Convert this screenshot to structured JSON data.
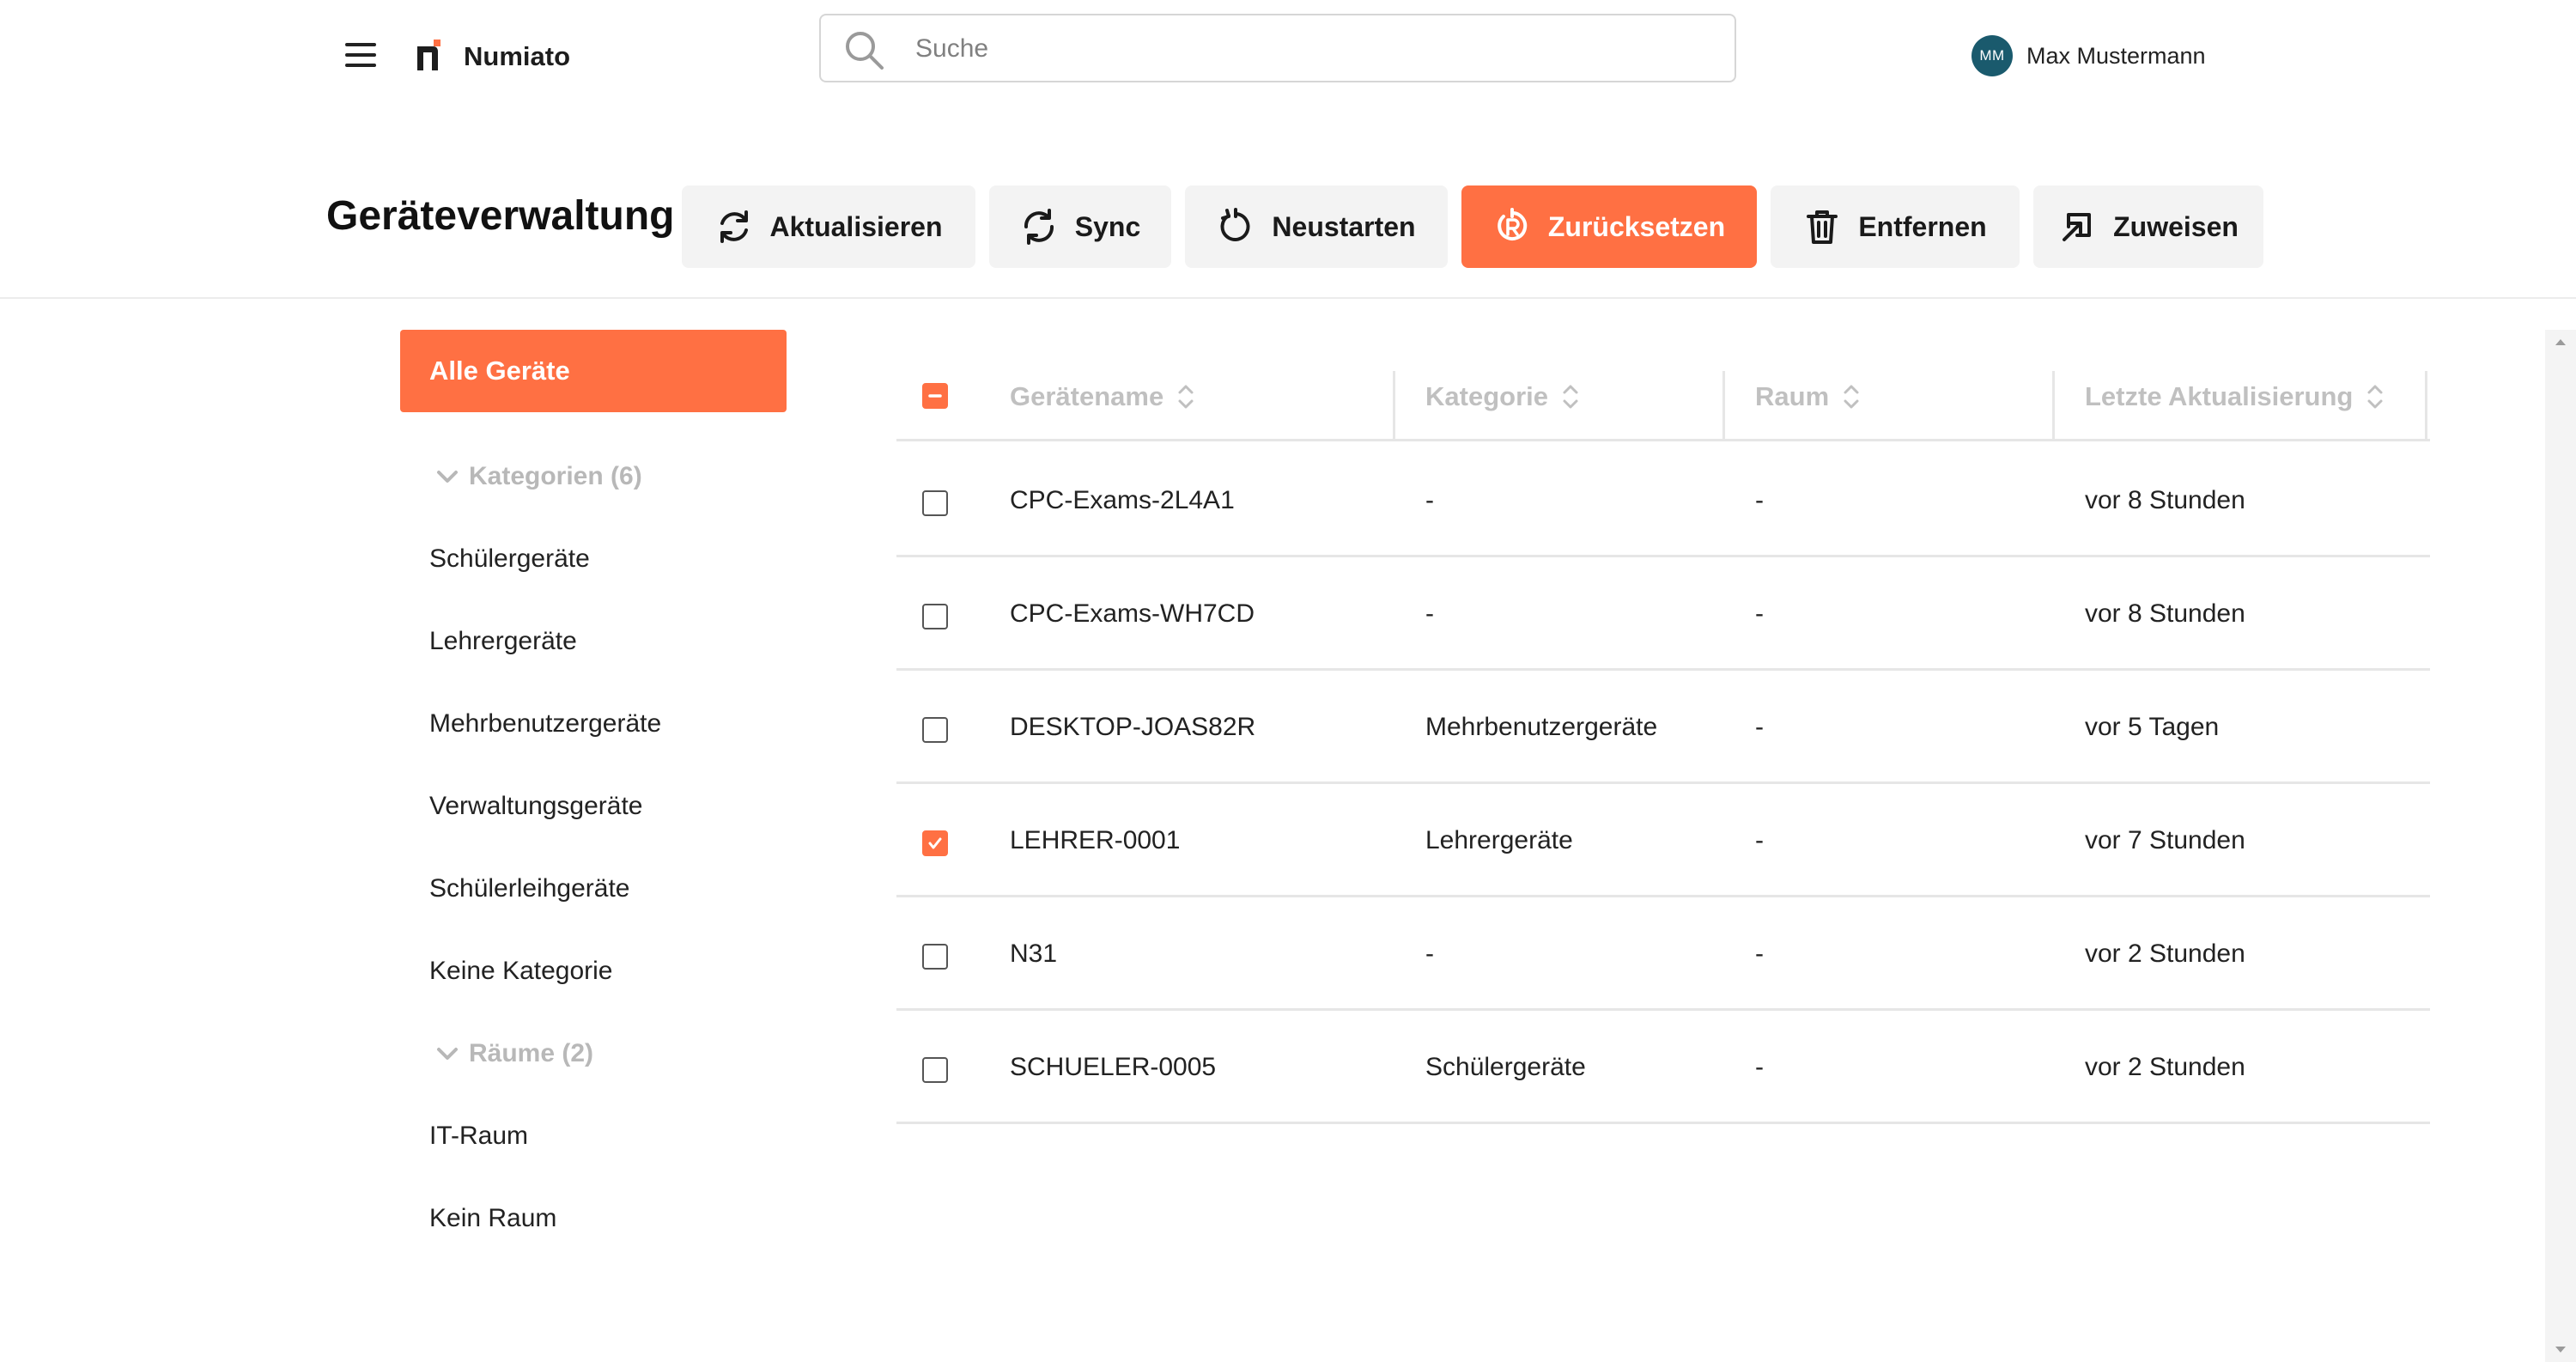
{
  "header": {
    "brand": "Numiato",
    "search_placeholder": "Suche",
    "user": {
      "initials": "MM",
      "name": "Max Mustermann"
    }
  },
  "page": {
    "title": "Geräteverwaltung",
    "actions": [
      {
        "label": "Aktualisieren",
        "icon": "refresh-icon"
      },
      {
        "label": "Sync",
        "icon": "sync-icon"
      },
      {
        "label": "Neustarten",
        "icon": "restart-icon"
      },
      {
        "label": "Zurücksetzen",
        "icon": "reset-icon",
        "primary": true
      },
      {
        "label": "Entfernen",
        "icon": "trash-icon"
      },
      {
        "label": "Zuweisen",
        "icon": "assign-icon"
      }
    ]
  },
  "sidebar": {
    "all_devices": "Alle Geräte",
    "categories_header": "Kategorien (6)",
    "categories": [
      "Schülergeräte",
      "Lehrergeräte",
      "Mehrbenutzergeräte",
      "Verwaltungsgeräte",
      "Schülerleihgeräte",
      "Keine Kategorie"
    ],
    "rooms_header": "Räume (2)",
    "rooms": [
      "IT-Raum",
      "Kein Raum"
    ]
  },
  "table": {
    "columns": [
      "Gerätename",
      "Kategorie",
      "Raum",
      "Letzte Aktualisierung"
    ],
    "rows": [
      {
        "name": "CPC-Exams-2L4A1",
        "category": "-",
        "room": "-",
        "updated": "vor 8 Stunden",
        "checked": false
      },
      {
        "name": "CPC-Exams-WH7CD",
        "category": "-",
        "room": "-",
        "updated": "vor 8 Stunden",
        "checked": false
      },
      {
        "name": "DESKTOP-JOAS82R",
        "category": "Mehrbenutzergeräte",
        "room": "-",
        "updated": "vor 5 Tagen",
        "checked": false
      },
      {
        "name": "LEHRER-0001",
        "category": "Lehrergeräte",
        "room": "-",
        "updated": "vor 7 Stunden",
        "checked": true
      },
      {
        "name": "N31",
        "category": "-",
        "room": "-",
        "updated": "vor 2 Stunden",
        "checked": false
      },
      {
        "name": "SCHUELER-0005",
        "category": "Schülergeräte",
        "room": "-",
        "updated": "vor 2 Stunden",
        "checked": false
      }
    ]
  },
  "colors": {
    "accent": "#ff7043",
    "avatar": "#1a5a6d"
  }
}
